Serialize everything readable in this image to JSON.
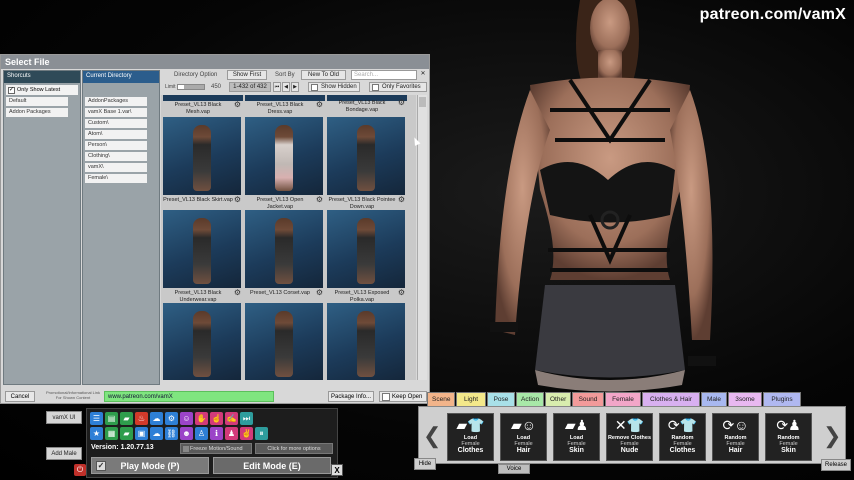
{
  "watermark": "patreon.com/vamX",
  "dialog": {
    "title": "Select File",
    "shortcuts": {
      "header": "Shorcuts",
      "only_show_latest": "Only Show Latest",
      "items": [
        "Default",
        "Addon Packages"
      ]
    },
    "current_directory": {
      "header": "Current Directory",
      "items": [
        "AddonPackages",
        "vamX Base 1.var\\",
        "Custom\\",
        "Atom\\",
        "Person\\",
        "Clothing\\",
        "vamX\\",
        "Female\\"
      ]
    },
    "toolbar": {
      "directory_option": "Directory Option",
      "show_first": "Show First",
      "sort_by": "Sort By",
      "sort_value": "New To Old",
      "search_placeholder": "Search...",
      "search_clear": "✕",
      "limit_label": "Limit",
      "limit_value": "450",
      "range": "1-432 of 432",
      "show_hidden": "Show Hidden",
      "only_favorites": "Only Favorites"
    },
    "top_captions": [
      "Preset_VL13 Black Mesh.vap",
      "Preset_VL13 Black Dress.vap",
      "Preset_VL13 Black Bondage.vap"
    ],
    "tiles": [
      {
        "caption": "Preset_VL13 Black Skirt.vap",
        "light": false
      },
      {
        "caption": "Preset_VL13 Open Jacket.vap",
        "light": true
      },
      {
        "caption": "Preset_VL13 Black Pointee Down.vap",
        "light": false
      },
      {
        "caption": "Preset_VL13 Black Underwear.vap",
        "light": false
      },
      {
        "caption": "Preset_VL13 Corset.vap",
        "light": false
      },
      {
        "caption": "Preset_VL13 Exposed Polka.vap",
        "light": false
      },
      {
        "caption": "",
        "light": false
      },
      {
        "caption": "",
        "light": false
      },
      {
        "caption": "",
        "light": false
      }
    ],
    "bottom": {
      "cancel": "Cancel",
      "promo": "Promotional/Informational Link For Shown Content",
      "url": "www.patreon.com/vamX",
      "package_info": "Package Info...",
      "keep_open": "Keep Open"
    }
  },
  "side": {
    "vamx_ui": "vamX UI",
    "add_male": "Add Male"
  },
  "control": {
    "version": "Version: 1.20.77.13",
    "freeze": "Freeze Motion/Sound",
    "more": "Click for more options",
    "play_mode": "Play Mode (P)",
    "edit_mode": "Edit Mode (E)",
    "close": "X",
    "row1_icons": [
      "menu",
      "chart",
      "folder",
      "flame",
      "cloud",
      "gear",
      "face",
      "hand",
      "hand2",
      "touch",
      "skip"
    ],
    "row2_icons": [
      "star",
      "chart2",
      "folder2",
      "camera",
      "cloud2",
      "link",
      "face2",
      "figure",
      "info",
      "person",
      "hand3",
      "pause"
    ]
  },
  "categories": [
    "Scene",
    "Light",
    "Pose",
    "Action",
    "Other",
    "Sound",
    "Female",
    "Clothes & Hair",
    "Male",
    "3some",
    "Plugins"
  ],
  "category_colors": [
    "#f2b48a",
    "#f3e88a",
    "#a8e0e8",
    "#a8e8a8",
    "#d8ecae",
    "#f29a9a",
    "#f2a6c8",
    "#d8b0f0",
    "#a8b8f0",
    "#e8b8f0",
    "#b0b8f0"
  ],
  "quick_actions": [
    {
      "icon": "folder-shirt",
      "l1": "Load",
      "l2": "Female",
      "l3": "Clothes"
    },
    {
      "icon": "folder-head",
      "l1": "Load",
      "l2": "Female",
      "l3": "Hair"
    },
    {
      "icon": "folder-person",
      "l1": "Load",
      "l2": "Female",
      "l3": "Skin"
    },
    {
      "icon": "x-shirt",
      "l1": "Remove Clothes",
      "l2": "Female",
      "l3": "Nude"
    },
    {
      "icon": "random-shirt",
      "l1": "Random",
      "l2": "Female",
      "l3": "Clothes"
    },
    {
      "icon": "random-head",
      "l1": "Random",
      "l2": "Female",
      "l3": "Hair"
    },
    {
      "icon": "random-person",
      "l1": "Random",
      "l2": "Female",
      "l3": "Skin"
    }
  ],
  "quick_nav": {
    "prev": "❮",
    "next": "❯"
  },
  "hide": "Hide",
  "voice": "Voice",
  "release": "Release"
}
